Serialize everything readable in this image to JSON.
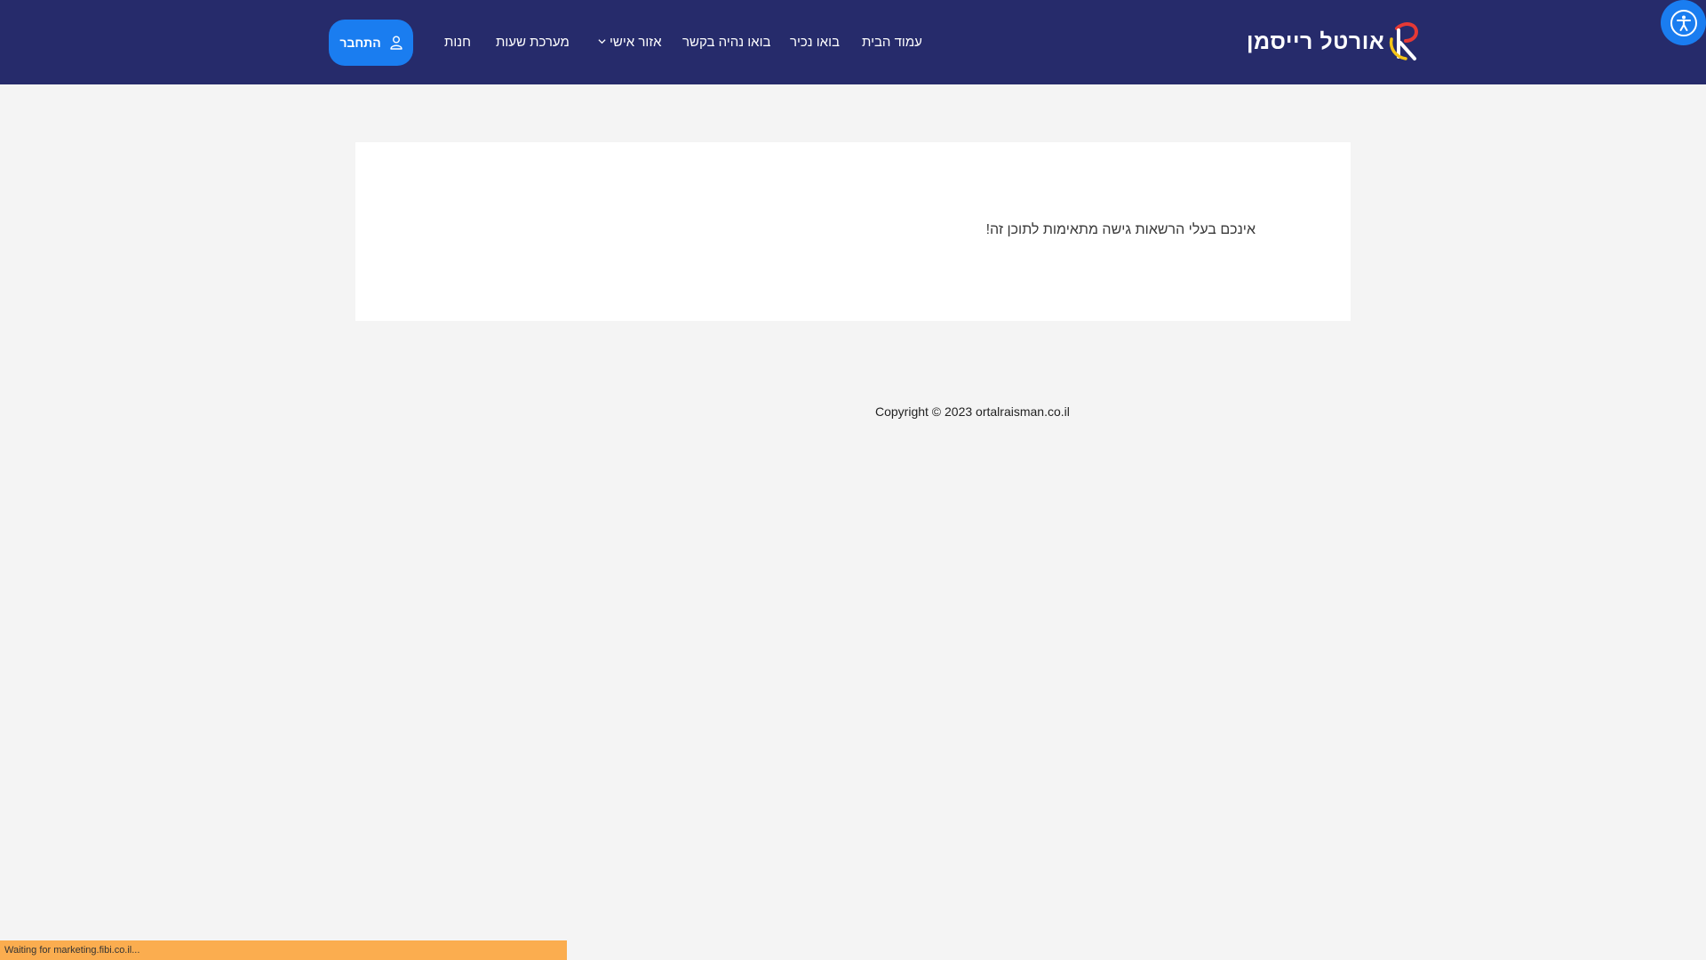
{
  "header": {
    "logo_text": "אורטל רייסמן",
    "nav": [
      {
        "label": "עמוד הבית"
      },
      {
        "label": "בואו נכיר"
      },
      {
        "label": "בואו נהיה בקשר"
      },
      {
        "label": "אזור אישי",
        "has_dropdown": true
      },
      {
        "label": "מערכת שעות"
      },
      {
        "label": "חנות"
      }
    ],
    "login_label": "התחבר"
  },
  "content": {
    "message": "אינכם בעלי הרשאות גישה מתאימות לתוכן זה!"
  },
  "footer": {
    "copyright": "Copyright © 2023 ortalraisman.co.il"
  },
  "status_bar": {
    "text": "Waiting for marketing.fibi.co.il..."
  },
  "icons": {
    "login": "user-icon",
    "accessibility": "accessibility-icon",
    "dropdown": "chevron-down-icon"
  },
  "colors": {
    "header_bg": "#262b6b",
    "accent": "#1a7df0",
    "page_bg": "#f4f4f4",
    "status_bar_bg": "#fbad4f"
  }
}
